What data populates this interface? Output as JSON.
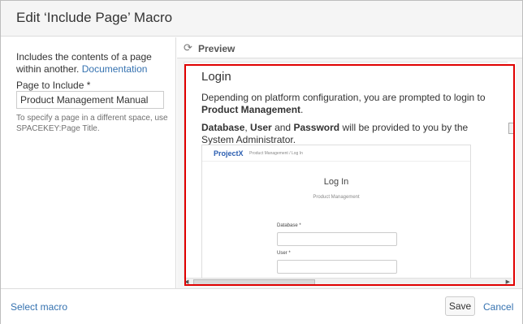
{
  "dialog": {
    "title": "Edit ‘Include Page’ Macro"
  },
  "left": {
    "description": "Includes the contents of a page within another.",
    "doc_link": "Documentation",
    "field_label": "Page to Include *",
    "field_value": "Product Management Manual",
    "help_text": "To specify a page in a different space, use SPACEKEY:Page Title."
  },
  "preview": {
    "label": "Preview",
    "refresh_icon": "refresh-icon",
    "heading": "Login",
    "para1_text": "Depending on platform configuration, you are prompted to login to",
    "para1_bold": "Product Management",
    "para1_end": ".",
    "para2_b1": "Database",
    "para2_t1": ", ",
    "para2_b2": "User",
    "para2_t2": " and ",
    "para2_b3": "Password",
    "para2_t3": " will be provided to you by the System Administrator.",
    "shot": {
      "logo": "ProjectX",
      "breadcrumb": "Product Management / Log In",
      "title": "Log In",
      "subtitle": "Product Management",
      "database_label": "Database *",
      "user_label": "User *"
    }
  },
  "footer": {
    "select_macro": "Select macro",
    "save": "Save",
    "cancel": "Cancel"
  },
  "colors": {
    "link": "#3572b0",
    "highlight": "#e00000"
  }
}
